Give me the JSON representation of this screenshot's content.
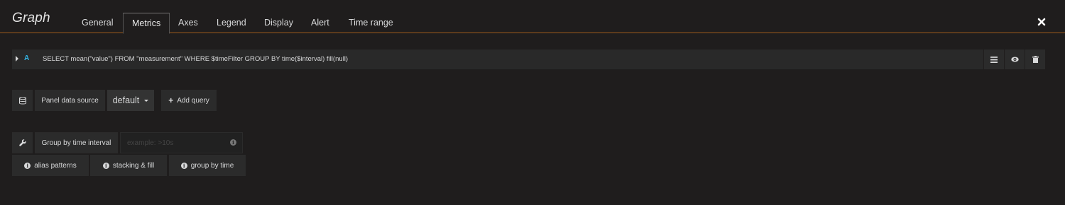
{
  "header": {
    "title": "Graph",
    "tabs": [
      "General",
      "Metrics",
      "Axes",
      "Legend",
      "Display",
      "Alert",
      "Time range"
    ],
    "active_tab": "Metrics",
    "close_icon": "close-icon"
  },
  "query": {
    "letter": "A",
    "text": "SELECT mean(\"value\") FROM \"measurement\" WHERE $timeFilter GROUP BY time($interval) fill(null)",
    "actions": [
      "menu-icon",
      "eye-icon",
      "trash-icon"
    ]
  },
  "datasource": {
    "label": "Panel data source",
    "selected": "default",
    "add_query_label": "Add query"
  },
  "group_by": {
    "label": "Group by time interval",
    "placeholder": "example: >10s"
  },
  "help": {
    "alias_patterns": "alias patterns",
    "stacking_fill": "stacking & fill",
    "group_by_time": "group by time"
  },
  "colors": {
    "background": "#1f1d1d",
    "accent_line": "#a05c1c",
    "query_letter": "#33b5e5"
  }
}
